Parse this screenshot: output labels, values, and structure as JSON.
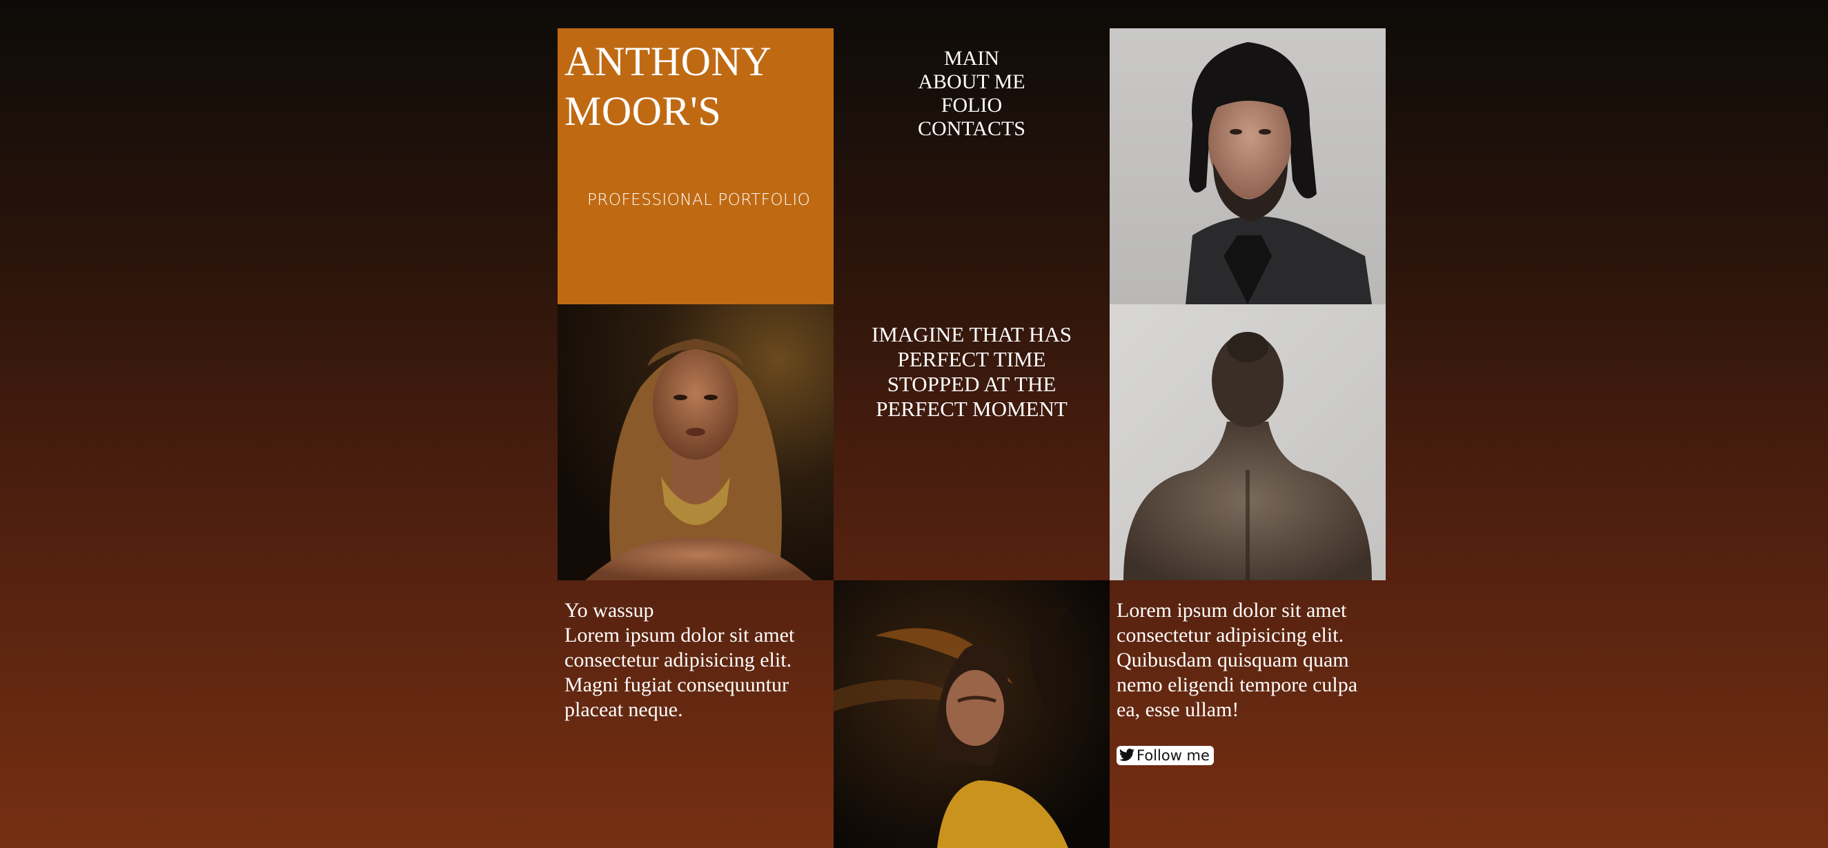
{
  "brand": {
    "title_line1": "ANTHONY",
    "title_line2": "MOOR'S",
    "subtitle": "PROFESSIONAL PORTFOLIO"
  },
  "nav": {
    "items": [
      "MAIN",
      "ABOUT ME",
      "FOLIO",
      "CONTACTS"
    ]
  },
  "quote": {
    "line1": "IMAGINE THAT HAS",
    "line2": "PERFECT TIME",
    "line3": "STOPPED AT THE",
    "line4": "PERFECT MOMENT"
  },
  "intro": {
    "greeting": "Yo wassup",
    "body": "Lorem ipsum dolor sit amet consectetur adipisicing elit. Magni fugiat consequuntur placeat neque."
  },
  "about": {
    "body": "Lorem ipsum dolor sit amet consectetur adipisicing elit. Quibusdam quisquam quam nemo eligendi tempore culpa ea, esse ullam!"
  },
  "follow": {
    "label": "Follow me",
    "icon": "twitter-bird-icon"
  },
  "colors": {
    "brand_block": "#bf6a13",
    "text": "#ffffff",
    "background_top": "#0d0b08",
    "background_bottom": "#762f12"
  }
}
